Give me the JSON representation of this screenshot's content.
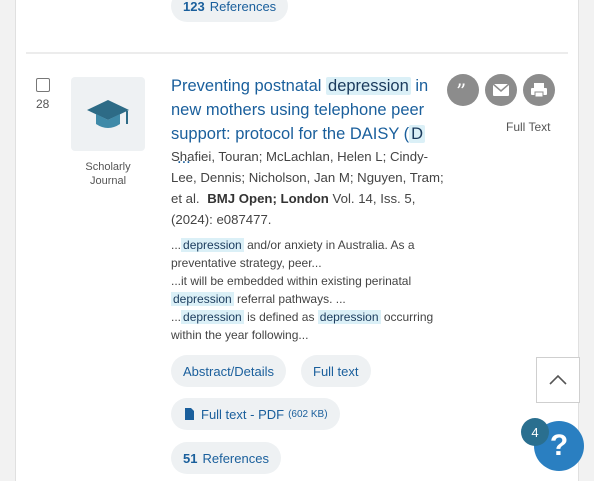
{
  "prev_result": {
    "ref_count": "123",
    "ref_label": "References"
  },
  "result": {
    "number": "28",
    "type_label": "Scholarly Journal",
    "title_pre": "Preventing postnatal ",
    "title_hl": "depression",
    "title_post": " in new mothers using telephone peer support: protocol for the DAISY (",
    "title_hl2": "D",
    "title_ellipsis": "...",
    "authors": "Shafiei, Touran; McLachlan, Helen L; Cindy-Lee, Dennis; Nicholson, Jan M; Nguyen, Tram; et al.",
    "journal": "BMJ Open; London",
    "citation": "Vol. 14, Iss. 5,  (2024): e087477.",
    "snippet": {
      "s1_pre": "...",
      "s1_hl": "depression",
      "s1_post": " and/or anxiety in Australia. As a preventative strategy, peer...",
      "s2_pre": "...it will be embedded within existing perinatal ",
      "s2_hl": "depression",
      "s2_post": " referral pathways. ...",
      "s3_pre": "...",
      "s3_hl": "depression",
      "s3_mid": " is defined as ",
      "s3_hl2": "depression",
      "s3_post": " occurring within the year following..."
    },
    "links": {
      "abstract": "Abstract/Details",
      "full_text": "Full text",
      "pdf_label": "Full text - PDF",
      "pdf_size": "(602 KB)",
      "ref_count": "51",
      "ref_label": "References"
    },
    "full_text_label": "Full Text"
  },
  "help": {
    "badge": "4",
    "icon": "?"
  },
  "icons": [
    "cite-icon",
    "email-icon",
    "print-icon",
    "chevron-up-icon",
    "scholarly-journal-icon"
  ]
}
